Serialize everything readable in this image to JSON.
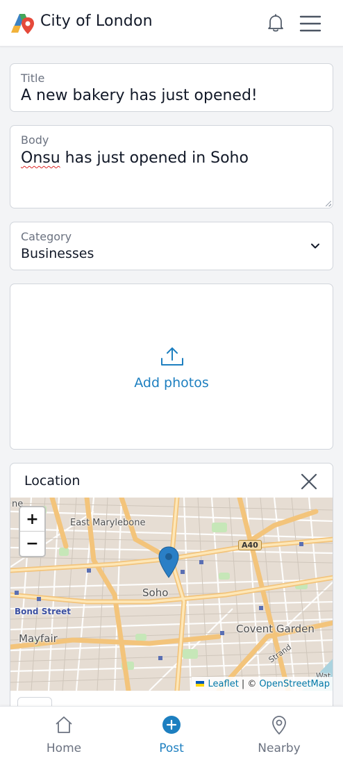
{
  "header": {
    "app_title": "City of London",
    "logo": "city-pin-logo",
    "notifications_icon": "bell-icon",
    "menu_icon": "hamburger-icon"
  },
  "form": {
    "title": {
      "label": "Title",
      "value": "A new bakery has just opened!"
    },
    "body": {
      "label": "Body",
      "value_misspelled": "Onsu",
      "value_rest": " has just opened in Soho"
    },
    "category": {
      "label": "Category",
      "value": "Businesses"
    },
    "photos": {
      "label": "Add photos",
      "icon": "upload-icon"
    },
    "location": {
      "label": "Location",
      "close_icon": "close-icon",
      "map": {
        "zoom_in": "+",
        "zoom_out": "−",
        "place_labels": [
          "East Marylebone",
          "Soho",
          "Bond Street",
          "Mayfair",
          "Covent Garden",
          "Strand",
          "A40",
          "ne",
          "Wat"
        ],
        "attribution": {
          "leaflet": "Leaflet",
          "separator": "| ©",
          "osm": "OpenStreetMap"
        }
      }
    }
  },
  "bottom_nav": {
    "items": [
      {
        "label": "Home",
        "icon": "home-icon",
        "active": false
      },
      {
        "label": "Post",
        "icon": "plus-circle-icon",
        "active": true
      },
      {
        "label": "Nearby",
        "icon": "map-pin-icon",
        "active": false
      }
    ]
  },
  "colors": {
    "accent": "#1d7fc0",
    "border": "#d1d5db",
    "background": "#f3f4f6",
    "muted_text": "#6b7280"
  }
}
